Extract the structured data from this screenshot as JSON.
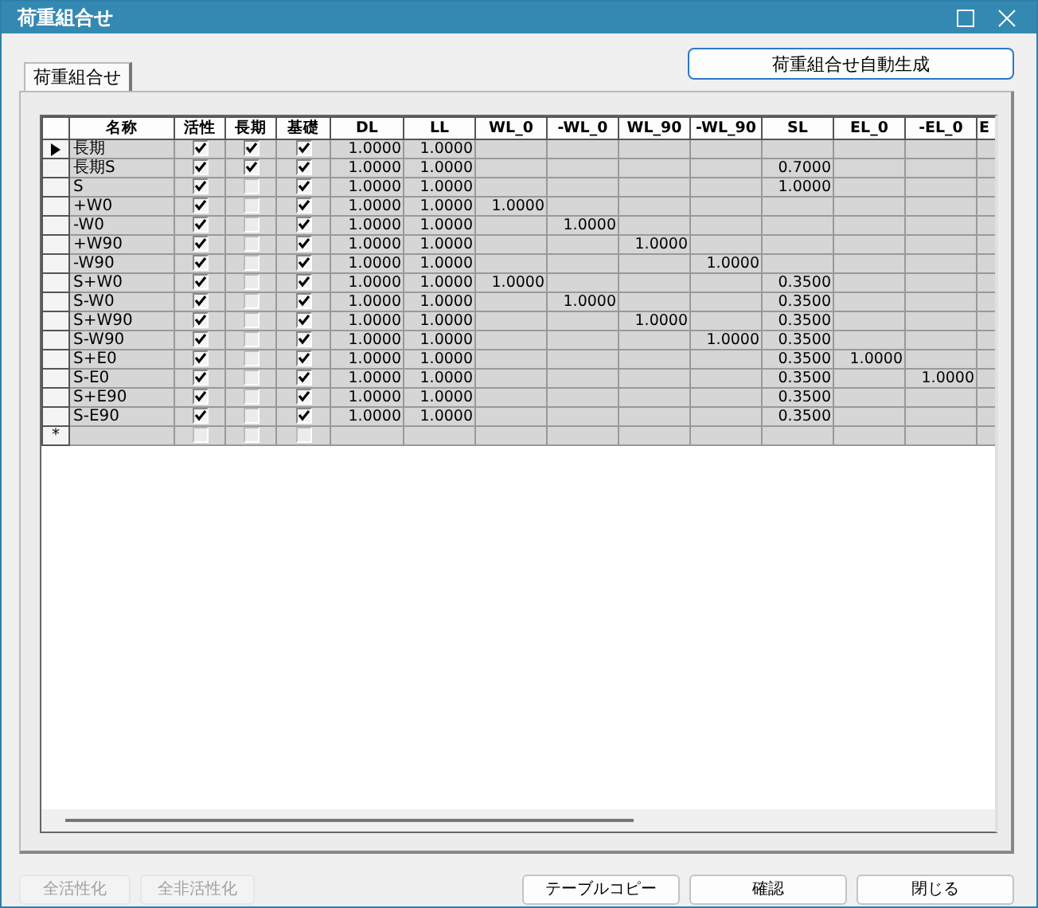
{
  "window": {
    "title": "荷重組合せ"
  },
  "tabs": [
    {
      "label": "荷重組合せ",
      "selected": true
    }
  ],
  "generate_button": "荷重組合せ自動生成",
  "table": {
    "columns": [
      "名称",
      "活性",
      "長期",
      "基礎",
      "DL",
      "LL",
      "WL_0",
      "-WL_0",
      "WL_90",
      "-WL_90",
      "SL",
      "EL_0",
      "-EL_0",
      "E"
    ],
    "rows": [
      {
        "current": true,
        "name": "長期",
        "active": true,
        "long_term": true,
        "foundation": true,
        "values": {
          "dl": "1.0000",
          "ll": "1.0000"
        }
      },
      {
        "current": false,
        "name": "長期S",
        "active": true,
        "long_term": true,
        "foundation": true,
        "values": {
          "dl": "1.0000",
          "ll": "1.0000",
          "sl": "0.7000"
        }
      },
      {
        "current": false,
        "name": "S",
        "active": true,
        "long_term": false,
        "foundation": true,
        "values": {
          "dl": "1.0000",
          "ll": "1.0000",
          "sl": "1.0000"
        }
      },
      {
        "current": false,
        "name": "+W0",
        "active": true,
        "long_term": false,
        "foundation": true,
        "values": {
          "dl": "1.0000",
          "ll": "1.0000",
          "wl_0": "1.0000"
        }
      },
      {
        "current": false,
        "name": "-W0",
        "active": true,
        "long_term": false,
        "foundation": true,
        "values": {
          "dl": "1.0000",
          "ll": "1.0000",
          "neg_wl_0": "1.0000"
        }
      },
      {
        "current": false,
        "name": "+W90",
        "active": true,
        "long_term": false,
        "foundation": true,
        "values": {
          "dl": "1.0000",
          "ll": "1.0000",
          "wl_90": "1.0000"
        }
      },
      {
        "current": false,
        "name": "-W90",
        "active": true,
        "long_term": false,
        "foundation": true,
        "values": {
          "dl": "1.0000",
          "ll": "1.0000",
          "neg_wl_90": "1.0000"
        }
      },
      {
        "current": false,
        "name": "S+W0",
        "active": true,
        "long_term": false,
        "foundation": true,
        "values": {
          "dl": "1.0000",
          "ll": "1.0000",
          "wl_0": "1.0000",
          "sl": "0.3500"
        }
      },
      {
        "current": false,
        "name": "S-W0",
        "active": true,
        "long_term": false,
        "foundation": true,
        "values": {
          "dl": "1.0000",
          "ll": "1.0000",
          "neg_wl_0": "1.0000",
          "sl": "0.3500"
        }
      },
      {
        "current": false,
        "name": "S+W90",
        "active": true,
        "long_term": false,
        "foundation": true,
        "values": {
          "dl": "1.0000",
          "ll": "1.0000",
          "wl_90": "1.0000",
          "sl": "0.3500"
        }
      },
      {
        "current": false,
        "name": "S-W90",
        "active": true,
        "long_term": false,
        "foundation": true,
        "values": {
          "dl": "1.0000",
          "ll": "1.0000",
          "neg_wl_90": "1.0000",
          "sl": "0.3500"
        }
      },
      {
        "current": false,
        "name": "S+E0",
        "active": true,
        "long_term": false,
        "foundation": true,
        "values": {
          "dl": "1.0000",
          "ll": "1.0000",
          "sl": "0.3500",
          "el_0": "1.0000"
        }
      },
      {
        "current": false,
        "name": "S-E0",
        "active": true,
        "long_term": false,
        "foundation": true,
        "values": {
          "dl": "1.0000",
          "ll": "1.0000",
          "sl": "0.3500",
          "neg_el_0": "1.0000"
        }
      },
      {
        "current": false,
        "name": "S+E90",
        "active": true,
        "long_term": false,
        "foundation": true,
        "values": {
          "dl": "1.0000",
          "ll": "1.0000",
          "sl": "0.3500"
        }
      },
      {
        "current": false,
        "name": "S-E90",
        "active": true,
        "long_term": false,
        "foundation": true,
        "values": {
          "dl": "1.0000",
          "ll": "1.0000",
          "sl": "0.3500"
        }
      }
    ],
    "new_row": {
      "marker": "*",
      "active": false,
      "long_term": false,
      "foundation": false
    }
  },
  "footer_buttons": [
    {
      "label": "全活性化",
      "disabled": true
    },
    {
      "label": "全非活性化",
      "disabled": true
    },
    {
      "label": "テーブルコピー",
      "disabled": false
    },
    {
      "label": "確認",
      "disabled": false
    },
    {
      "label": "閉じる",
      "disabled": false
    }
  ]
}
